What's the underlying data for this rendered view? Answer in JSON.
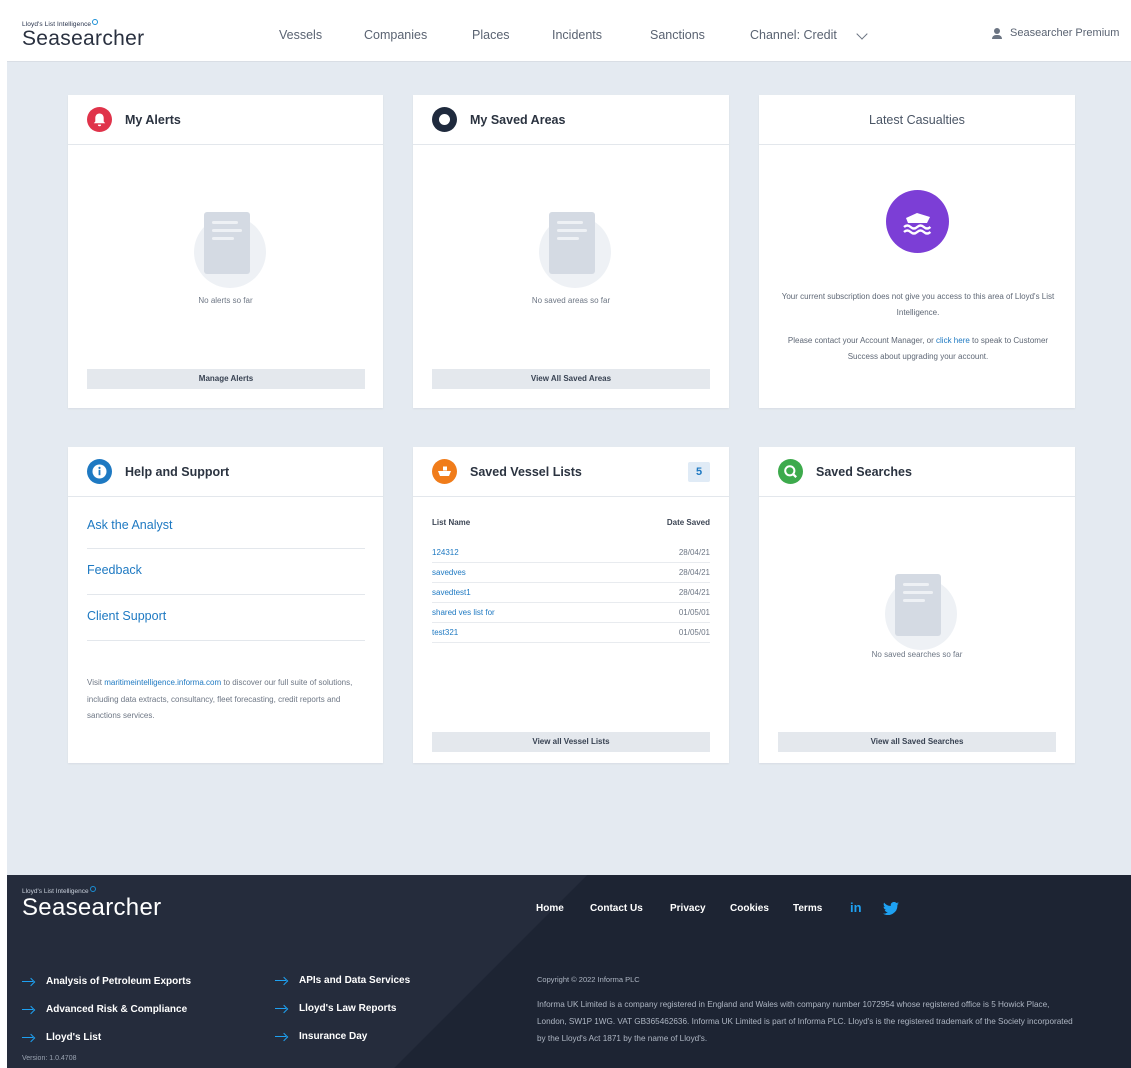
{
  "header": {
    "brand_small": "Lloyd's List Intelligence",
    "brand_name": "Seasearcher",
    "nav": [
      "Vessels",
      "Companies",
      "Places",
      "Incidents",
      "Sanctions"
    ],
    "channel": "Channel: Credit",
    "user": "Seasearcher Premium"
  },
  "alerts": {
    "title": "My Alerts",
    "empty": "No alerts so far",
    "button": "Manage Alerts"
  },
  "areas": {
    "title": "My Saved Areas",
    "empty": "No saved areas so far",
    "button": "View All Saved Areas"
  },
  "casualties": {
    "title": "Latest Casualties",
    "msg1": "Your current subscription does not give you access to this area of Lloyd's List Intelligence.",
    "msg2_pre": "Please contact your Account Manager, or ",
    "msg2_link": "click here",
    "msg2_post": " to speak to Customer Success about upgrading your account."
  },
  "help": {
    "title": "Help and Support",
    "links": [
      "Ask the Analyst",
      "Feedback",
      "Client Support"
    ],
    "note_pre": "Visit ",
    "note_link": "maritimeintelligence.informa.com",
    "note_post": " to discover our full suite of solutions, including data extracts, consultancy, fleet forecasting, credit reports and sanctions services."
  },
  "vessel_lists": {
    "title": "Saved Vessel Lists",
    "count": "5",
    "col_name": "List Name",
    "col_date": "Date Saved",
    "rows": [
      {
        "name": "124312",
        "date": "28/04/21"
      },
      {
        "name": "savedves",
        "date": "28/04/21"
      },
      {
        "name": "savedtest1",
        "date": "28/04/21"
      },
      {
        "name": "shared ves list for",
        "date": "01/05/01"
      },
      {
        "name": "test321",
        "date": "01/05/01"
      }
    ],
    "button": "View all Vessel Lists"
  },
  "searches": {
    "title": "Saved Searches",
    "empty": "No saved searches so far",
    "button": "View all Saved Searches"
  },
  "footer": {
    "brand_small": "Lloyd's List Intelligence",
    "brand_name": "Seasearcher",
    "nav": [
      "Home",
      "Contact Us",
      "Privacy",
      "Cookies",
      "Terms"
    ],
    "links_left": [
      "Analysis of Petroleum Exports",
      "Advanced Risk & Compliance",
      "Lloyd's List"
    ],
    "links_right": [
      "APIs and Data Services",
      "Lloyd's Law Reports",
      "Insurance Day"
    ],
    "copyright": "Copyright © 2022 Informa PLC",
    "legal": "Informa UK Limited is a company registered in England and Wales with company number 1072954 whose registered office is 5 Howick Place, London, SW1P 1WG. VAT GB365462636. Informa UK Limited is part of Informa PLC. Lloyd's is the registered trademark of the Society incorporated by the Lloyd's Act 1871 by the name of Lloyd's.",
    "version": "Version: 1.0.4708"
  },
  "colors": {
    "alerts_icon": "#e0334a",
    "areas_icon": "#1f2a3d",
    "help_icon": "#1e79c2",
    "vessel_icon": "#f07c1a",
    "search_icon": "#3daa4c",
    "casualty_icon": "#7c3ed6"
  }
}
